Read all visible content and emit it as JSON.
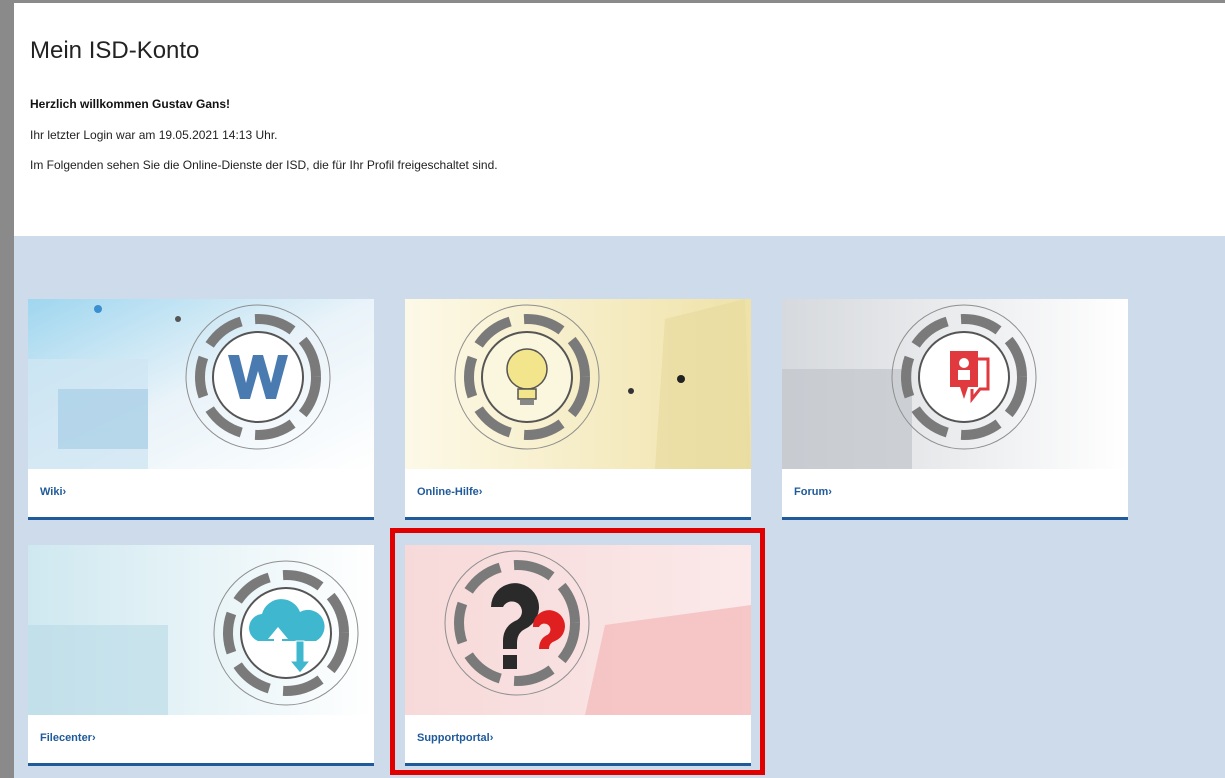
{
  "page": {
    "title": "Mein ISD-Konto",
    "welcome": "Herzlich willkommen Gustav Gans!",
    "last_login": "Ihr letzter Login war am 19.05.2021 14:13 Uhr.",
    "info": "Im Folgenden sehen Sie die Online-Dienste der ISD, die für Ihr Profil freigeschaltet sind."
  },
  "tiles": [
    {
      "label": "Wiki",
      "icon": "wiki-w-icon",
      "accent": "#4a7bb0"
    },
    {
      "label": "Online-Hilfe",
      "icon": "lightbulb-icon",
      "accent": "#f3e58c"
    },
    {
      "label": "Forum",
      "icon": "forum-chat-icon",
      "accent": "#e0393e"
    },
    {
      "label": "Filecenter",
      "icon": "cloud-upload-download-icon",
      "accent": "#3fb7cf"
    },
    {
      "label": "Supportportal",
      "icon": "question-mark-icon",
      "accent": "#e02020"
    }
  ],
  "tile_link_suffix": "›",
  "highlighted_tile": "Supportportal",
  "colors": {
    "background": "#cddbea",
    "link": "#1f5a9a",
    "highlight": "#e00000"
  }
}
